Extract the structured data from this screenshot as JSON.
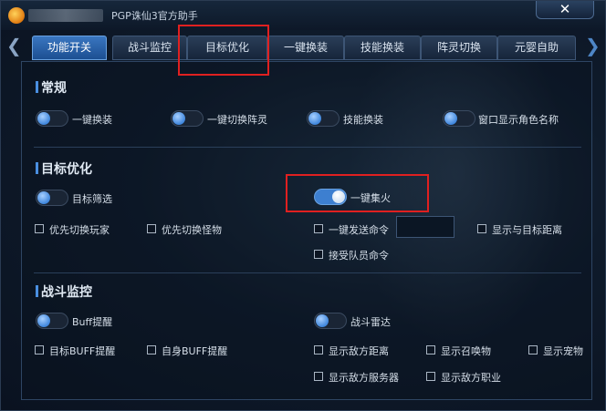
{
  "window": {
    "title": "PGP诛仙3官方助手",
    "close_glyph": "✕"
  },
  "nav": {
    "prev_glyph": "❮",
    "next_glyph": "❯"
  },
  "tabs": [
    {
      "label": "功能开关",
      "active": true
    },
    {
      "label": "战斗监控",
      "active": false
    },
    {
      "label": "目标优化",
      "active": false
    },
    {
      "label": "一键换装",
      "active": false
    },
    {
      "label": "技能换装",
      "active": false
    },
    {
      "label": "阵灵切换",
      "active": false
    },
    {
      "label": "元婴自助",
      "active": false
    }
  ],
  "sections": {
    "general": {
      "title": "常规",
      "toggles": [
        {
          "label": "一键换装",
          "on": false
        },
        {
          "label": "一键切换阵灵",
          "on": false
        },
        {
          "label": "技能换装",
          "on": false
        },
        {
          "label": "窗口显示角色名称",
          "on": false
        }
      ]
    },
    "target": {
      "title": "目标优化",
      "toggles": [
        {
          "label": "目标筛选",
          "on": false
        },
        {
          "label": "一键集火",
          "on": true
        }
      ],
      "checkboxes": [
        {
          "label": "优先切换玩家",
          "checked": false
        },
        {
          "label": "优先切换怪物",
          "checked": false
        },
        {
          "label": "一键发送命令",
          "checked": false
        },
        {
          "label": "显示与目标距离",
          "checked": false
        },
        {
          "label": "接受队员命令",
          "checked": false
        }
      ],
      "command_input": ""
    },
    "combat": {
      "title": "战斗监控",
      "toggles": [
        {
          "label": "Buff提醒",
          "on": false
        },
        {
          "label": "战斗雷达",
          "on": false
        }
      ],
      "checkboxes": [
        {
          "label": "目标BUFF提醒",
          "checked": false
        },
        {
          "label": "自身BUFF提醒",
          "checked": false
        },
        {
          "label": "显示敌方距离",
          "checked": false
        },
        {
          "label": "显示召唤物",
          "checked": false
        },
        {
          "label": "显示宠物",
          "checked": false
        },
        {
          "label": "显示敌方服务器",
          "checked": false
        },
        {
          "label": "显示敌方职业",
          "checked": false
        }
      ]
    }
  },
  "colors": {
    "accent": "#3d7fd0",
    "highlight": "#e02020"
  }
}
